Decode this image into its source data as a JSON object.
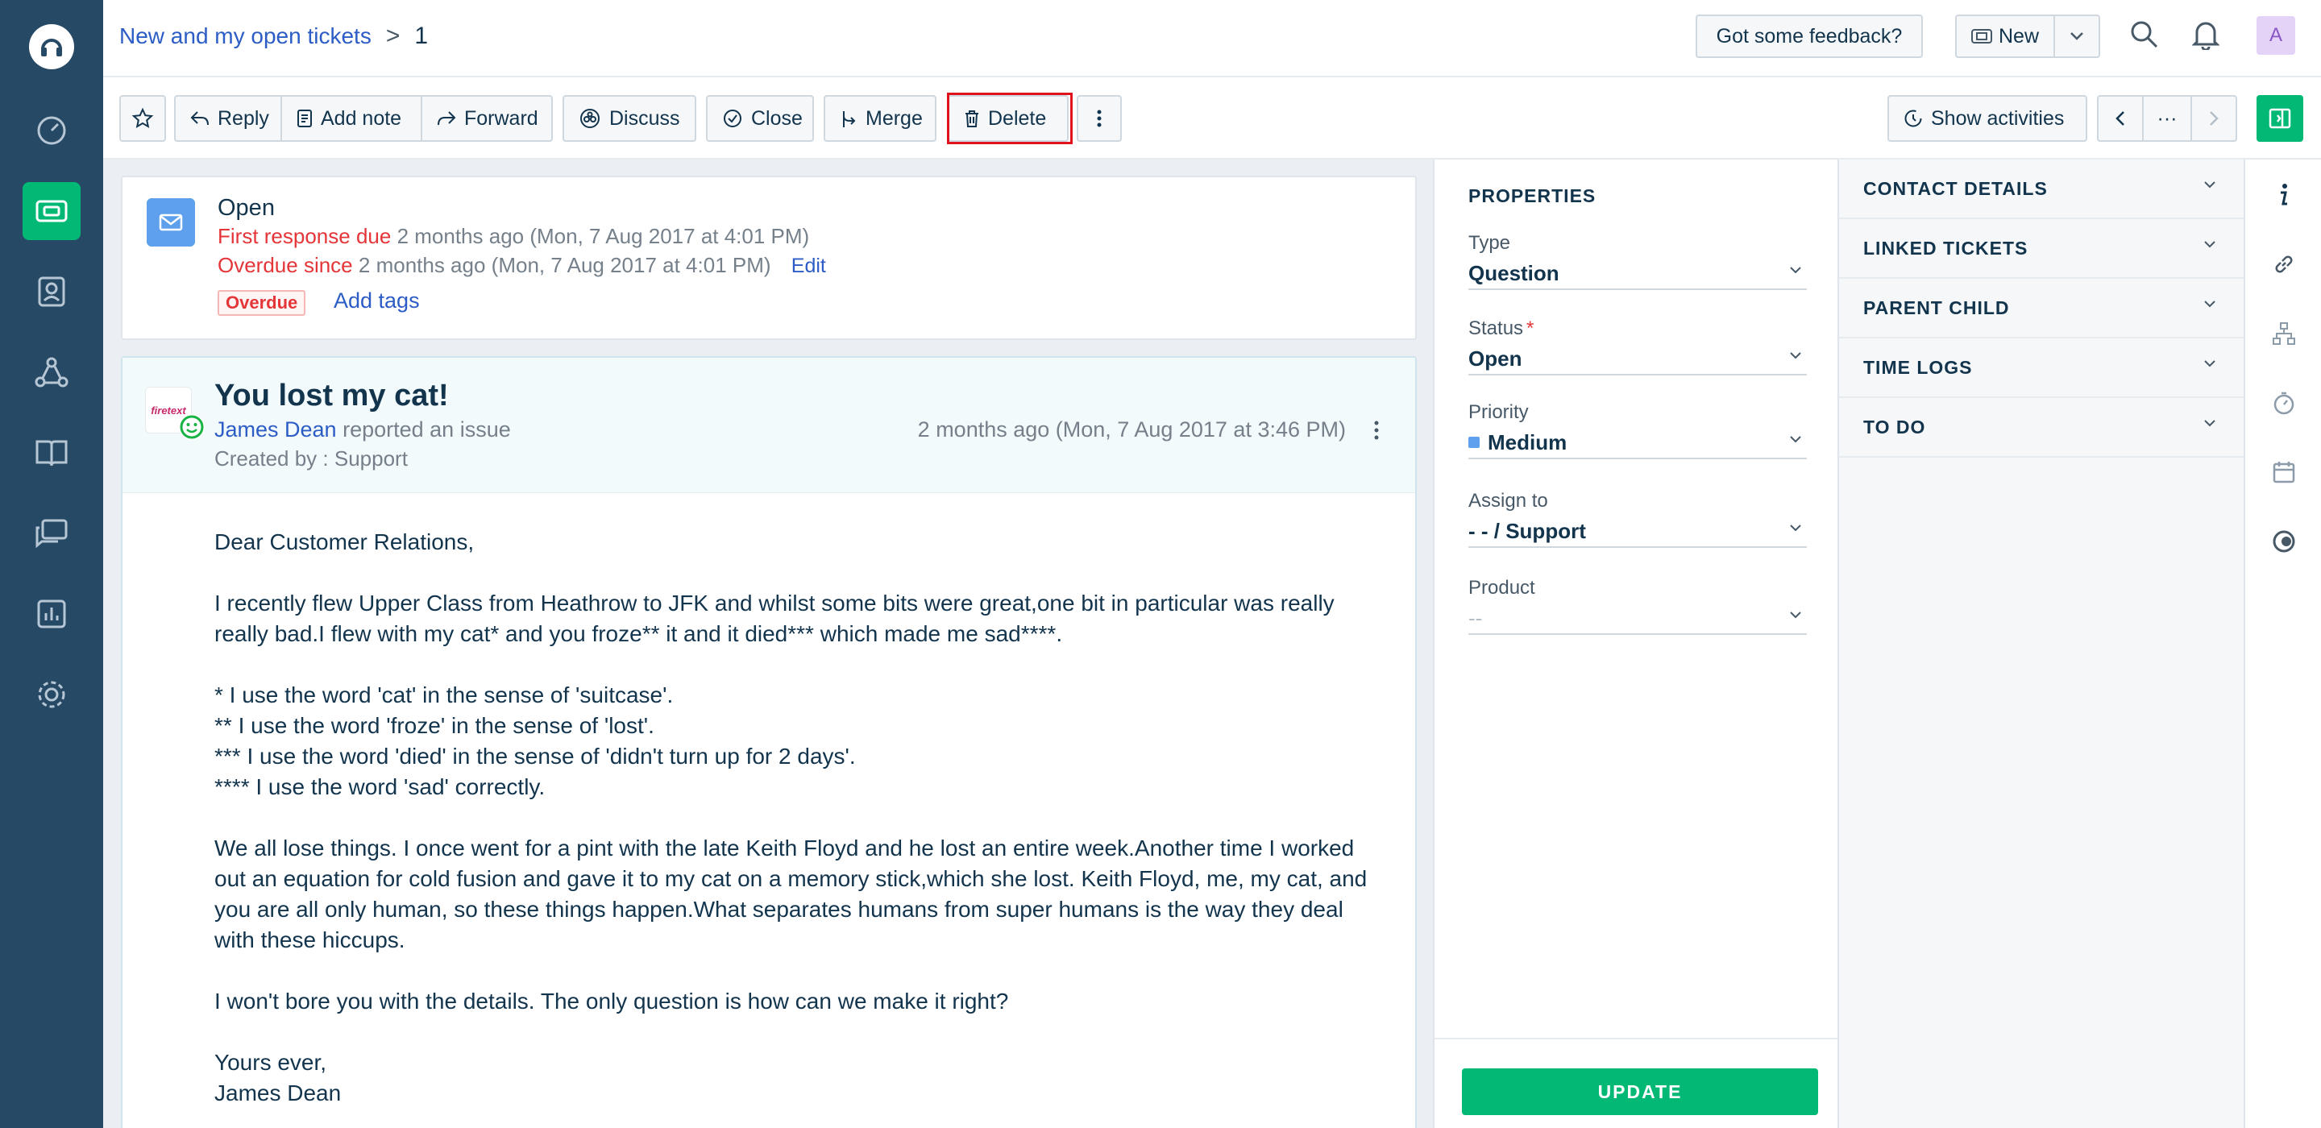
{
  "header": {
    "breadcrumb_view": "New and my open tickets",
    "breadcrumb_sep": ">",
    "ticket_number": "1",
    "feedback_label": "Got some feedback?",
    "new_label": "New",
    "user_initial": "A"
  },
  "toolbar": {
    "reply": "Reply",
    "add_note": "Add note",
    "forward": "Forward",
    "discuss": "Discuss",
    "close": "Close",
    "merge": "Merge",
    "delete": "Delete",
    "show_activities": "Show activities",
    "ellipsis": "···"
  },
  "status": {
    "title": "Open",
    "first_response_label": "First response due",
    "first_response_value": "2 months ago (Mon, 7 Aug 2017 at 4:01 PM)",
    "overdue_label": "Overdue since",
    "overdue_value": "2 months ago (Mon, 7 Aug 2017 at 4:01 PM)",
    "edit": "Edit",
    "badge": "Overdue",
    "add_tags": "Add tags"
  },
  "conversation": {
    "avatar_text": "firetext",
    "subject": "You lost my cat!",
    "requester": "James Dean",
    "action": "reported an issue",
    "created_by": "Created by : Support",
    "time": "2 months ago (Mon, 7 Aug 2017 at 3:46 PM)",
    "body": {
      "greeting": "Dear Customer Relations,",
      "p1": "I recently flew Upper Class from Heathrow to JFK and whilst some bits were great,one bit in particular was really really bad.I flew with my cat* and you froze** it and it died*** which made me sad****.",
      "f1": "* I use the word 'cat' in the sense of 'suitcase'.",
      "f2": "** I use the word 'froze' in the sense of 'lost'.",
      "f3": "*** I use the word 'died' in the sense of 'didn't turn up for 2 days'.",
      "f4": "**** I use the word 'sad' correctly.",
      "p2": "We all lose things. I once went for a pint with the late Keith Floyd and he lost an entire week.Another time I worked out an equation for cold fusion and gave it to my cat on a memory stick,which she lost. Keith Floyd, me, my cat, and you are all only human, so these things happen.What separates humans from super humans is the way they deal with these hiccups.",
      "p3": "I won't bore you with the details. The only question is how can we make it right?",
      "signoff": "Yours ever,",
      "signature": "James Dean"
    }
  },
  "properties": {
    "title": "PROPERTIES",
    "type_label": "Type",
    "type_value": "Question",
    "status_label": "Status",
    "status_required": "*",
    "status_value": "Open",
    "priority_label": "Priority",
    "priority_value": "Medium",
    "priority_color": "#5ea0ec",
    "assign_label": "Assign to",
    "assign_value": "- - / Support",
    "product_label": "Product",
    "product_value": "--",
    "update": "UPDATE"
  },
  "accordion": {
    "contact_details": "CONTACT DETAILS",
    "linked_tickets": "LINKED TICKETS",
    "parent_child": "PARENT CHILD",
    "time_logs": "TIME LOGS",
    "to_do": "TO DO"
  },
  "colors": {
    "nav_bg": "#264966",
    "accent_green": "#02b875",
    "link_blue": "#2c5cc5",
    "danger_red": "#e43538"
  }
}
